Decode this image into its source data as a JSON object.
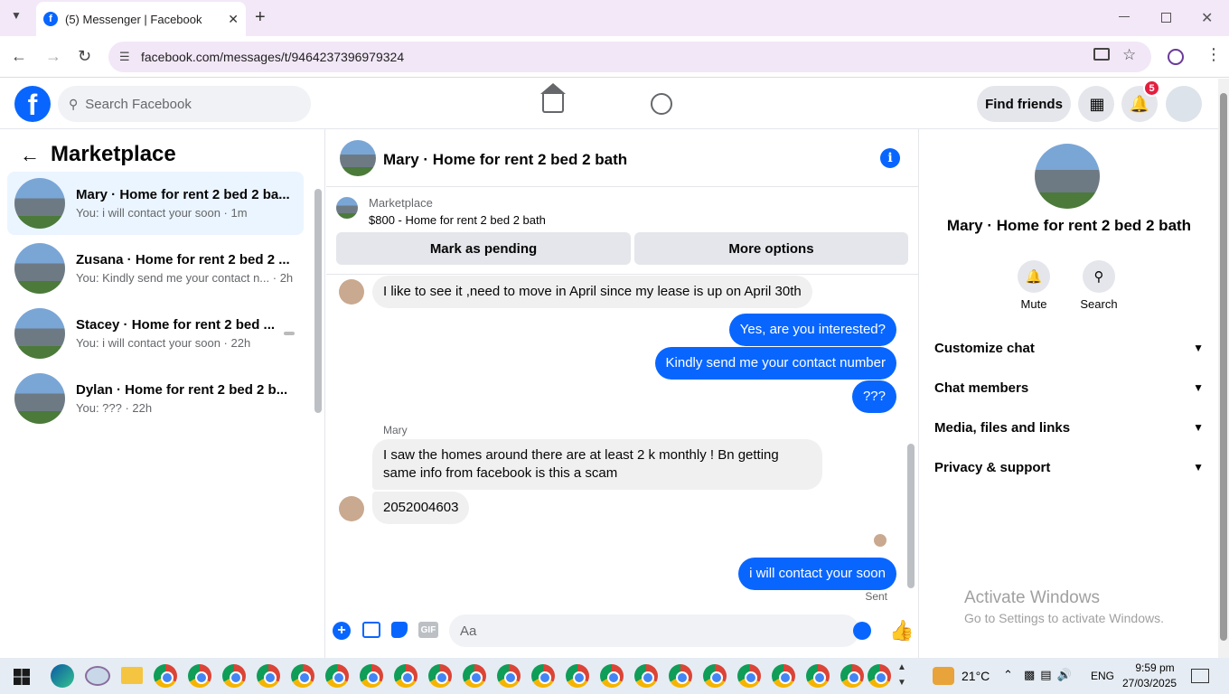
{
  "browser": {
    "tab_title": "(5) Messenger | Facebook",
    "url": "facebook.com/messages/t/9464237396979324",
    "new_tab": "+",
    "tab_close": "✕"
  },
  "fb_header": {
    "logo": "f",
    "search_placeholder": "Search Facebook",
    "find_friends": "Find friends",
    "notification_count": "5"
  },
  "left": {
    "title": "Marketplace",
    "conversations": [
      {
        "name": "Mary · Home for rent 2 bed 2 ba...",
        "preview": "You: i will contact your soon · 1m"
      },
      {
        "name": "Zusana · Home for rent 2 bed 2 ...",
        "preview": "You: Kindly send me your contact n... · 2h"
      },
      {
        "name": "Stacey · Home for rent 2 bed ...",
        "preview": "You: i will contact your soon · 22h"
      },
      {
        "name": "Dylan · Home for rent 2 bed 2 b...",
        "preview": "You: ??? · 22h"
      }
    ]
  },
  "chat": {
    "title": "Mary · Home for rent 2 bed 2 bath",
    "marketplace_label": "Marketplace",
    "listing": "$800 - Home for rent 2 bed 2 bath",
    "mark_pending": "Mark as pending",
    "more_options": "More options",
    "messages": {
      "in1": "I like to see it ,need to move in April since my lease is up on April 30th",
      "out1": "Yes, are you interested?",
      "out2": "Kindly send me your contact number",
      "out3": "???",
      "sender": "Mary",
      "in2": "I saw the homes around there are at least 2 k monthly ! Bn getting same info from facebook is this a scam",
      "in3": "2052004603",
      "out4": "i will contact your soon",
      "status": "Sent"
    },
    "composer_placeholder": "Aa",
    "gif": "GIF"
  },
  "right": {
    "name": "Mary · Home for rent 2 bed 2 bath",
    "mute": "Mute",
    "search": "Search",
    "sections": [
      "Customize chat",
      "Chat members",
      "Media, files and links",
      "Privacy & support"
    ]
  },
  "watermark": {
    "line1": "Activate Windows",
    "line2": "Go to Settings to activate Windows."
  },
  "taskbar": {
    "temp": "21°C",
    "lang": "ENG",
    "time": "9:59 pm",
    "date": "27/03/2025"
  },
  "colors": {
    "brand": "#0866ff",
    "badge": "#e41e3f",
    "bubble_in": "#f0f0f0"
  }
}
